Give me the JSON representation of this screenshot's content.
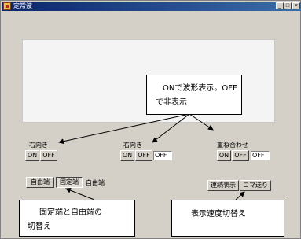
{
  "window": {
    "title": "定常波",
    "minimize_glyph": "_",
    "maximize_glyph": "□",
    "close_glyph": "×"
  },
  "groups": {
    "left": {
      "label": "右向き",
      "on": "ON",
      "off": "OFF"
    },
    "middle": {
      "label": "右向き",
      "on": "ON",
      "off": "OFF",
      "state": "OFF"
    },
    "right": {
      "label": "重ね合わせ",
      "on": "ON",
      "off": "OFF",
      "state": "OFF"
    }
  },
  "end_mode": {
    "free_end_label": "自由端",
    "fixed_end_label": "固定端",
    "state": "自由端"
  },
  "speed": {
    "continuous_label": "連続表示",
    "step_label": "コマ送り"
  },
  "callouts": {
    "on_off": {
      "line1": "ONで波形表示。OFF",
      "line2": "で非表示"
    },
    "end_switch": {
      "line1": "固定端と自由端の",
      "line2": "切替え"
    },
    "speed_switch": {
      "line1": "表示速度切替え"
    }
  }
}
